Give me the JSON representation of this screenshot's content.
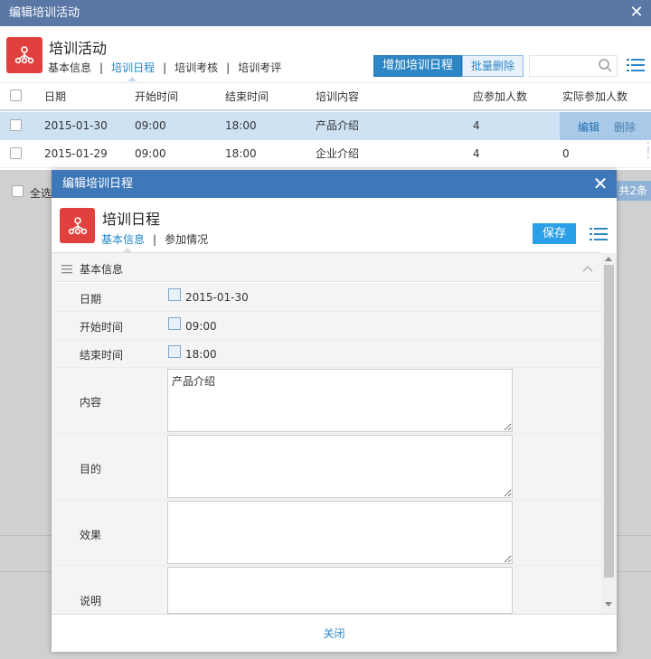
{
  "outer": {
    "title": "编辑培训活动",
    "header_title": "培训活动",
    "tabs": [
      "基本信息",
      "培训日程",
      "培训考核",
      "培训考评"
    ],
    "add_button": "增加培训日程",
    "batch_delete": "批量删除",
    "columns": [
      "日期",
      "开始时间",
      "结束时间",
      "培训内容",
      "应参加人数",
      "实际参加人数"
    ],
    "rows": [
      {
        "date": "2015-01-30",
        "start": "09:00",
        "end": "18:00",
        "content": "产品介绍",
        "planned": "4",
        "actual": "",
        "edit": "编辑",
        "delete": "删除"
      },
      {
        "date": "2015-01-29",
        "start": "09:00",
        "end": "18:00",
        "content": "企业介绍",
        "planned": "4",
        "actual": "0"
      }
    ],
    "select_all": "全选",
    "total": "共2条",
    "accent": "#2d86c6"
  },
  "dialog": {
    "title": "编辑培训日程",
    "header_title": "培训日程",
    "tabs": [
      "基本信息",
      "参加情况"
    ],
    "save": "保存",
    "section": "基本信息",
    "fields": {
      "date_label": "日期",
      "date_value": "2015-01-30",
      "start_label": "开始时间",
      "start_value": "09:00",
      "end_label": "结束时间",
      "end_value": "18:00",
      "content_label": "内容",
      "content_value": "产品介绍",
      "purpose_label": "目的",
      "purpose_value": "",
      "effect_label": "效果",
      "effect_value": "",
      "note_label": "说明",
      "note_value": ""
    },
    "close": "关闭"
  }
}
